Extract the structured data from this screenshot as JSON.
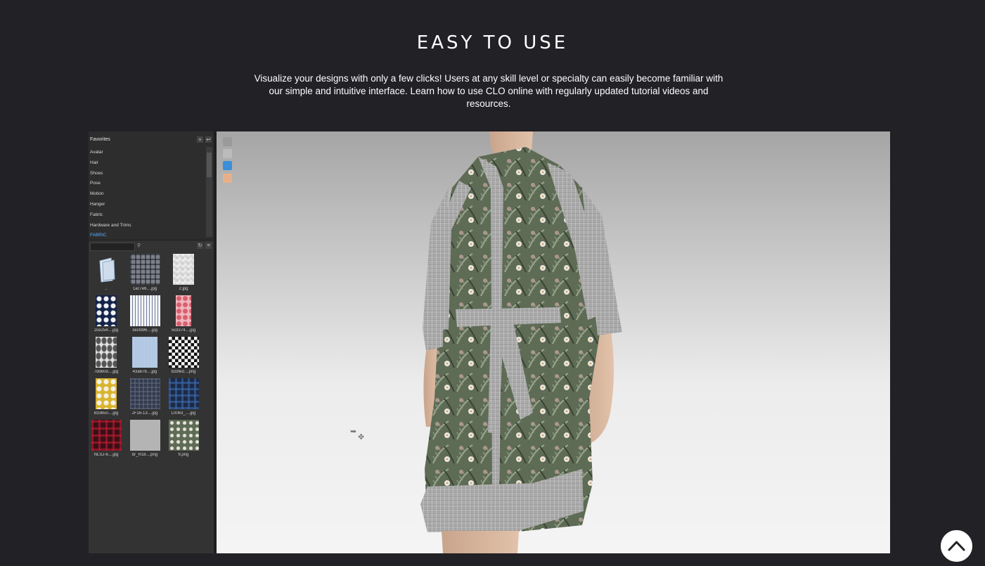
{
  "hero": {
    "title": "EASY TO USE",
    "description": "Visualize your designs with only a few clicks! Users at any skill level or specialty can easily become familiar with our simple and intuitive interface. Learn how to use CLO online with regularly updated tutorial videos and resources."
  },
  "library": {
    "header": "Favorites",
    "add_icon": "plus-icon",
    "back_icon": "back-arrow-icon",
    "items": [
      "Avatar",
      "Hair",
      "Shoes",
      "Pose",
      "Motion",
      "Hanger",
      "Fabric",
      "Hardware and Trims",
      "FABRIC"
    ],
    "active_item": "FABRIC"
  },
  "search": {
    "value": "",
    "placeholder": ""
  },
  "files": [
    {
      "label": "..",
      "kind": "folder"
    },
    {
      "label": "1ac7e6....jpg",
      "kind": "plaid-gray"
    },
    {
      "label": "2.jpg",
      "kind": "white-texture"
    },
    {
      "label": "2ce254....jpg",
      "kind": "navy-floral"
    },
    {
      "label": "3ecfd96....jpg",
      "kind": "stripe"
    },
    {
      "label": "5cd374....jpg",
      "kind": "pink-floral"
    },
    {
      "label": "7dd60d....jpg",
      "kind": "gray-leaf"
    },
    {
      "label": "43a678....jpg",
      "kind": "light-blue"
    },
    {
      "label": "82dfed....png",
      "kind": "checker"
    },
    {
      "label": "833650....jpg",
      "kind": "yellow-floral"
    },
    {
      "label": "JF16-13....jpg",
      "kind": "navy-plaid"
    },
    {
      "label": "L0063_....jpg",
      "kind": "blue-plaid"
    },
    {
      "label": "NLSJ-6....jpg",
      "kind": "red-plaid"
    },
    {
      "label": "br_R18....png",
      "kind": "gray-plain"
    },
    {
      "label": "fl.png",
      "kind": "green-floral"
    }
  ],
  "viewport_icons": [
    "display-mode-icon",
    "avatar-icon",
    "garment-icon",
    "skin-icon"
  ],
  "colors": {
    "page_bg": "#222126",
    "accent_link": "#5ab0ff",
    "dress_green": "#5e6b55",
    "dress_gray": "#a8a8a8"
  }
}
